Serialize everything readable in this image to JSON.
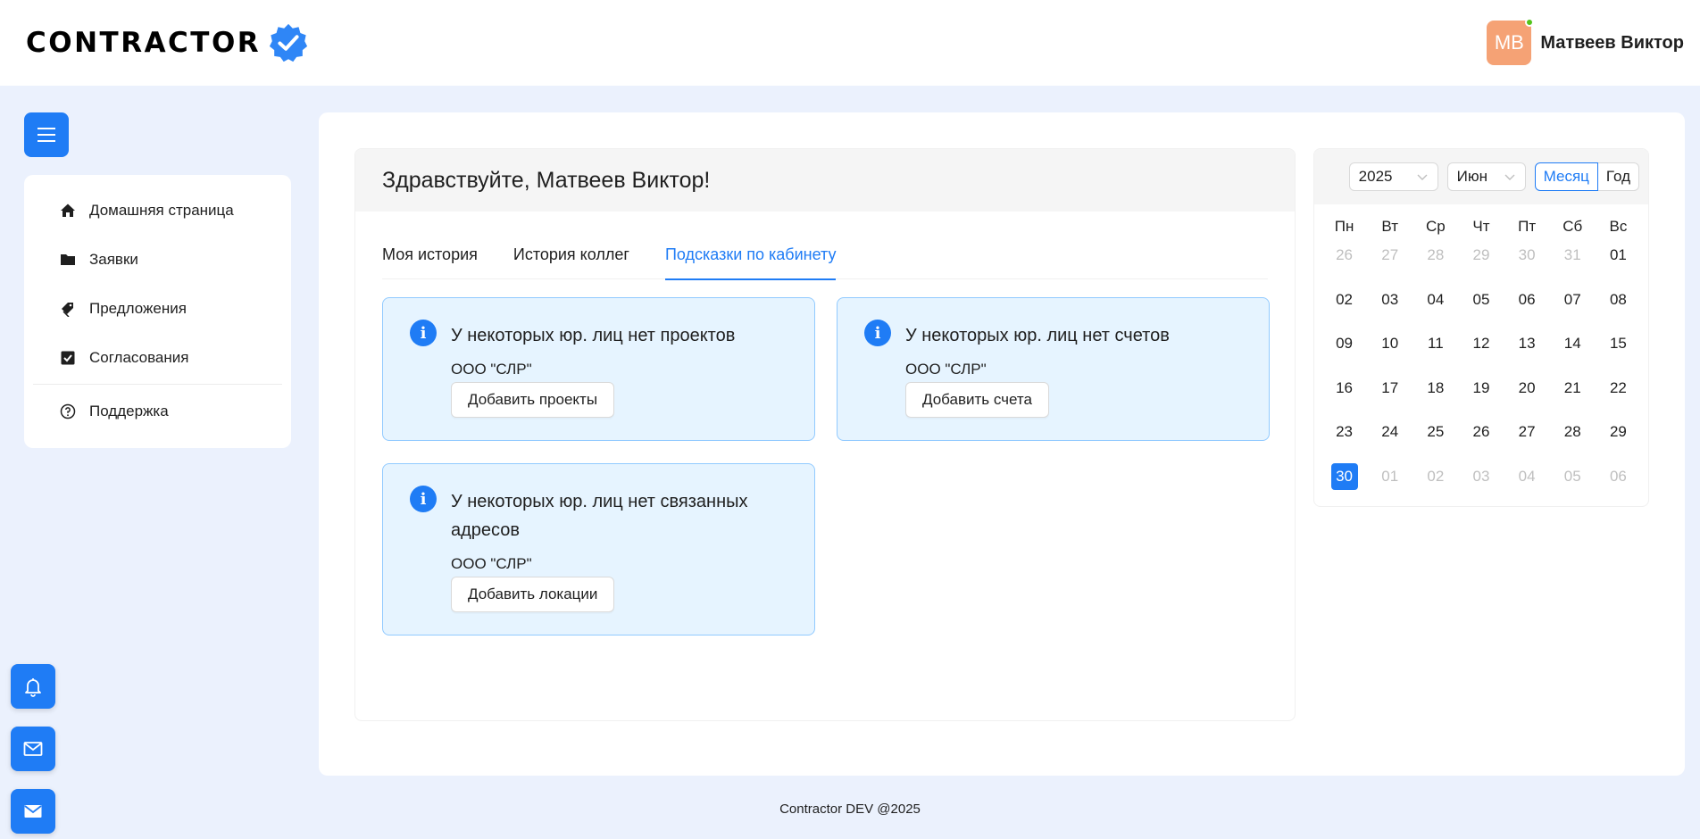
{
  "header": {
    "logo_text": "CONTRACTOR",
    "user_initials": "МВ",
    "user_name": "Матвеев Виктор"
  },
  "sidebar": {
    "items": [
      {
        "label": "Домашняя страница",
        "icon": "home-icon"
      },
      {
        "label": "Заявки",
        "icon": "folder-icon"
      },
      {
        "label": "Предложения",
        "icon": "tags-icon"
      },
      {
        "label": "Согласования",
        "icon": "check-square-icon"
      },
      {
        "label": "Поддержка",
        "icon": "question-circle-icon"
      }
    ]
  },
  "main": {
    "greeting": "Здравствуйте, Матвеев Виктор!",
    "tabs": [
      {
        "label": "Моя история"
      },
      {
        "label": "История коллег"
      },
      {
        "label": "Подсказки по кабинету"
      }
    ],
    "alerts": [
      {
        "title": "У некоторых юр. лиц нет проектов",
        "company": "ООО \"СЛР\"",
        "button": "Добавить проекты"
      },
      {
        "title": "У некоторых юр. лиц нет счетов",
        "company": "ООО \"СЛР\"",
        "button": "Добавить счета"
      },
      {
        "title": "У некоторых юр. лиц нет связанных адресов",
        "company": "ООО \"СЛР\"",
        "button": "Добавить локации"
      }
    ]
  },
  "calendar": {
    "year": "2025",
    "month": "Июн",
    "mode_month": "Месяц",
    "mode_year": "Год",
    "weekdays": [
      "Пн",
      "Вт",
      "Ср",
      "Чт",
      "Пт",
      "Сб",
      "Вс"
    ],
    "days": [
      {
        "d": "26",
        "muted": true
      },
      {
        "d": "27",
        "muted": true
      },
      {
        "d": "28",
        "muted": true
      },
      {
        "d": "29",
        "muted": true
      },
      {
        "d": "30",
        "muted": true
      },
      {
        "d": "31",
        "muted": true
      },
      {
        "d": "01",
        "muted": false
      },
      {
        "d": "02",
        "muted": false
      },
      {
        "d": "03",
        "muted": false
      },
      {
        "d": "04",
        "muted": false
      },
      {
        "d": "05",
        "muted": false
      },
      {
        "d": "06",
        "muted": false
      },
      {
        "d": "07",
        "muted": false
      },
      {
        "d": "08",
        "muted": false
      },
      {
        "d": "09",
        "muted": false
      },
      {
        "d": "10",
        "muted": false
      },
      {
        "d": "11",
        "muted": false
      },
      {
        "d": "12",
        "muted": false
      },
      {
        "d": "13",
        "muted": false
      },
      {
        "d": "14",
        "muted": false
      },
      {
        "d": "15",
        "muted": false
      },
      {
        "d": "16",
        "muted": false
      },
      {
        "d": "17",
        "muted": false
      },
      {
        "d": "18",
        "muted": false
      },
      {
        "d": "19",
        "muted": false
      },
      {
        "d": "20",
        "muted": false
      },
      {
        "d": "21",
        "muted": false
      },
      {
        "d": "22",
        "muted": false
      },
      {
        "d": "23",
        "muted": false
      },
      {
        "d": "24",
        "muted": false
      },
      {
        "d": "25",
        "muted": false
      },
      {
        "d": "26",
        "muted": false
      },
      {
        "d": "27",
        "muted": false
      },
      {
        "d": "28",
        "muted": false
      },
      {
        "d": "29",
        "muted": false
      },
      {
        "d": "30",
        "muted": false,
        "selected": true
      },
      {
        "d": "01",
        "muted": true
      },
      {
        "d": "02",
        "muted": true
      },
      {
        "d": "03",
        "muted": true
      },
      {
        "d": "04",
        "muted": true
      },
      {
        "d": "05",
        "muted": true
      },
      {
        "d": "06",
        "muted": true
      }
    ]
  },
  "footer": {
    "text": "Contractor DEV @2025"
  },
  "colors": {
    "accent": "#1f7cf5",
    "avatar": "#f5a275",
    "alert_bg": "#e6f4ff",
    "alert_border": "#91caff"
  }
}
